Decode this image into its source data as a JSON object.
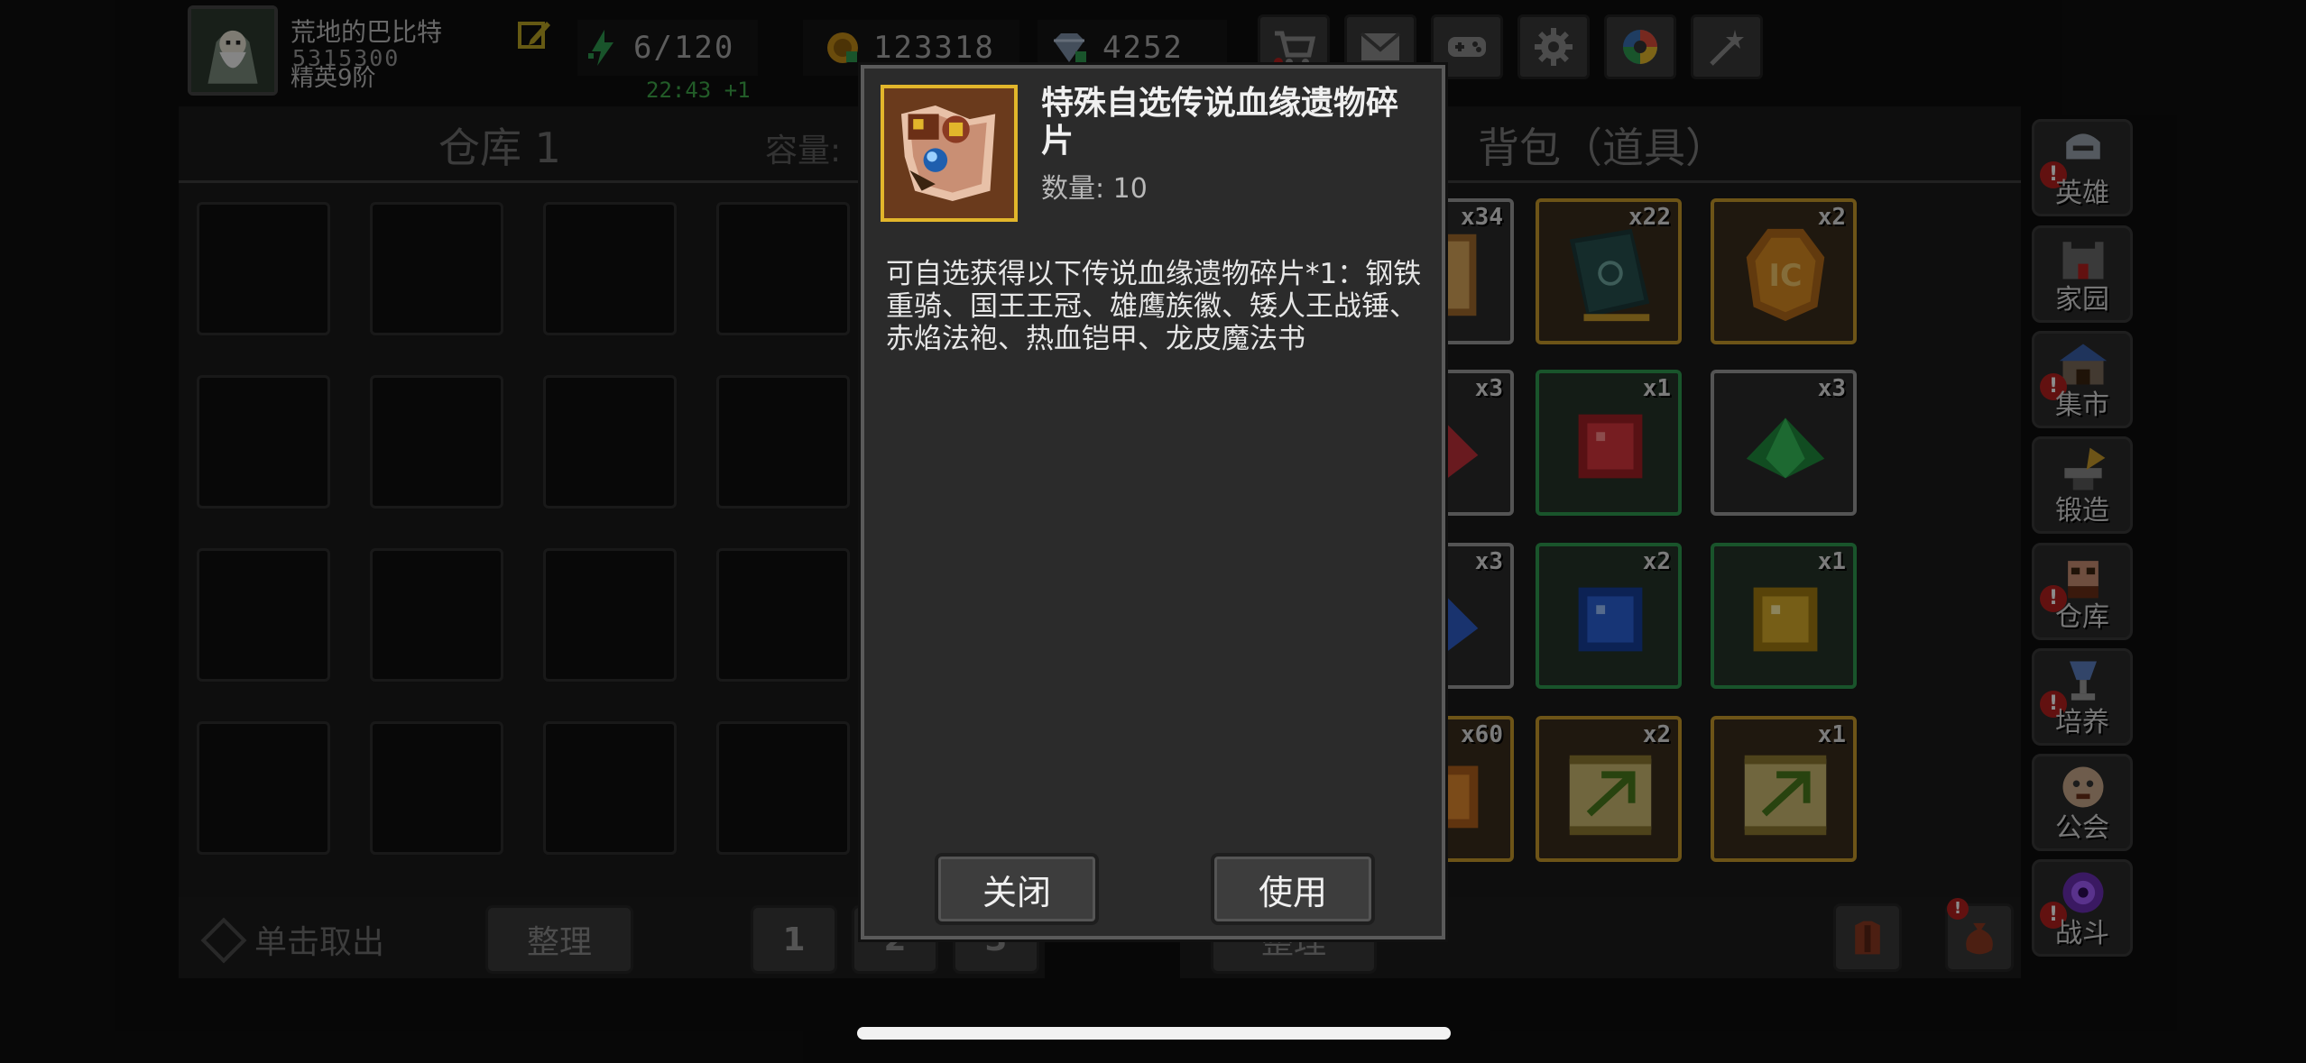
{
  "player": {
    "name": "荒地的巴比特",
    "id": "5315300",
    "rank": "精英9阶",
    "energy": "6/120",
    "energy_timer": "22:43 +1",
    "gold": "123318",
    "gems": "4252"
  },
  "top_buttons": [
    "shop-icon",
    "mail-icon",
    "gamepad-icon",
    "gear-icon",
    "palette-icon",
    "wand-icon"
  ],
  "warehouse": {
    "title": "仓库 1",
    "capacity_label": "容量:",
    "take_label": "单击取出",
    "sort_label": "整理",
    "pages": [
      "1",
      "2",
      "3"
    ]
  },
  "backpack": {
    "title": "背包（道具）",
    "sort_label": "整理",
    "slots": [
      {
        "qty": "x34",
        "rarity": "gray",
        "icon": "book-icon"
      },
      {
        "qty": "x22",
        "rarity": "gold",
        "icon": "dark-book-icon"
      },
      {
        "qty": "x2",
        "rarity": "gold",
        "icon": "ic-medal-icon"
      },
      {
        "qty": "x3",
        "rarity": "gray",
        "icon": "red-crystal-icon"
      },
      {
        "qty": "x1",
        "rarity": "green",
        "icon": "red-cube-icon"
      },
      {
        "qty": "x3",
        "rarity": "gray",
        "icon": "green-gem-icon"
      },
      {
        "qty": "x3",
        "rarity": "gray",
        "icon": "blue-crystal-icon"
      },
      {
        "qty": "x2",
        "rarity": "green",
        "icon": "blue-cube-icon"
      },
      {
        "qty": "x1",
        "rarity": "green",
        "icon": "yellow-cube-icon"
      },
      {
        "qty": "x60",
        "rarity": "gold",
        "icon": "orange-item-icon"
      },
      {
        "qty": "x2",
        "rarity": "gold",
        "icon": "scroll-icon"
      },
      {
        "qty": "x1",
        "rarity": "gold",
        "icon": "scroll-icon"
      }
    ]
  },
  "sidebar": [
    {
      "label": "英雄",
      "alert": true
    },
    {
      "label": "家园",
      "alert": false
    },
    {
      "label": "集市",
      "alert": true
    },
    {
      "label": "锻造",
      "alert": false
    },
    {
      "label": "仓库",
      "alert": true
    },
    {
      "label": "培养",
      "alert": true
    },
    {
      "label": "公会",
      "alert": false
    },
    {
      "label": "战斗",
      "alert": true
    }
  ],
  "dialog": {
    "item_name": "特殊自选传说血缘遗物碎片",
    "quantity": "数量: 10",
    "description": "可自选获得以下传说血缘遗物碎片*1：钢铁重骑、国王王冠、雄鹰族徽、矮人王战锤、赤焰法袍、热血铠甲、龙皮魔法书",
    "close_label": "关闭",
    "use_label": "使用"
  },
  "colors": {
    "background": "#0e0e0e",
    "panel": "#1a1a1a",
    "dialog": "#2b2b2b",
    "gold_border": "#c79a2a",
    "green_border": "#2f9a4f",
    "alert": "#b3201e",
    "timer": "#3fa84a"
  }
}
